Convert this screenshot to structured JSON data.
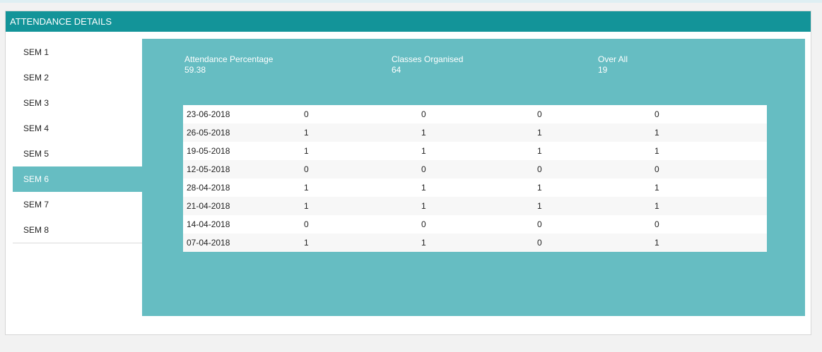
{
  "header": {
    "title": "ATTENDANCE DETAILS"
  },
  "sidebar": {
    "items": [
      {
        "label": "SEM 1"
      },
      {
        "label": "SEM 2"
      },
      {
        "label": "SEM 3"
      },
      {
        "label": "SEM 4"
      },
      {
        "label": "SEM 5"
      },
      {
        "label": "SEM 6"
      },
      {
        "label": "SEM 7"
      },
      {
        "label": "SEM 8"
      }
    ],
    "active": "SEM 6"
  },
  "summary": {
    "attendance_percentage": {
      "label": "Attendance Percentage",
      "value": "59.38"
    },
    "classes_organised": {
      "label": "Classes Organised",
      "value": "64"
    },
    "over_all": {
      "label": "Over All",
      "value": "19"
    }
  },
  "table": {
    "rows": [
      [
        "23-06-2018",
        "0",
        "0",
        "0",
        "0"
      ],
      [
        "26-05-2018",
        "1",
        "1",
        "1",
        "1"
      ],
      [
        "19-05-2018",
        "1",
        "1",
        "1",
        "1"
      ],
      [
        "12-05-2018",
        "0",
        "0",
        "0",
        "0"
      ],
      [
        "28-04-2018",
        "1",
        "1",
        "1",
        "1"
      ],
      [
        "21-04-2018",
        "1",
        "1",
        "1",
        "1"
      ],
      [
        "14-04-2018",
        "0",
        "0",
        "0",
        "0"
      ],
      [
        "07-04-2018",
        "1",
        "1",
        "0",
        "1"
      ]
    ]
  },
  "colors": {
    "header": "#139499",
    "accent": "#66bdc2"
  }
}
